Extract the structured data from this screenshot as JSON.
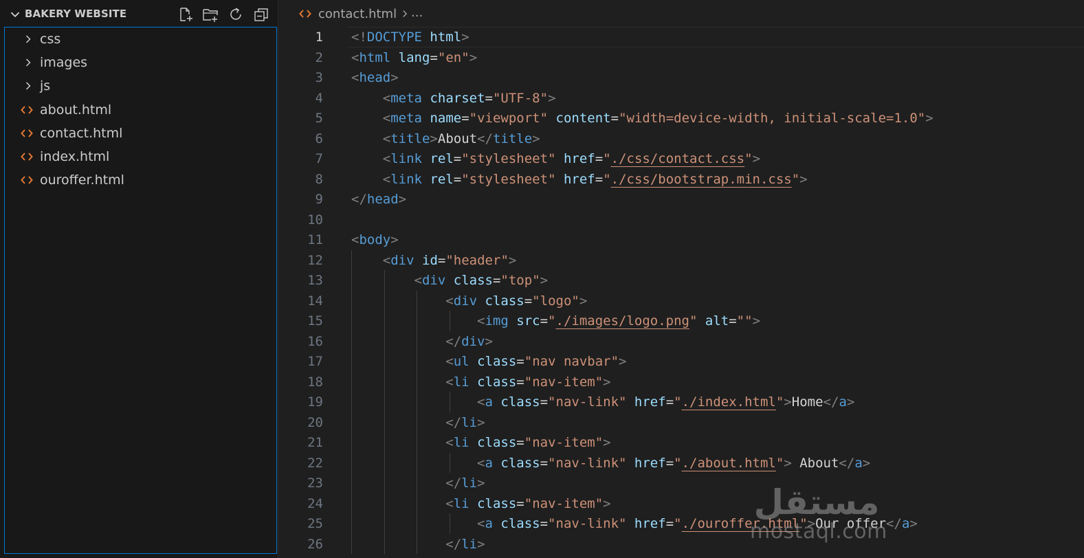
{
  "explorer": {
    "title": "BAKERY WEBSITE",
    "actions": [
      {
        "name": "new-file-icon"
      },
      {
        "name": "new-folder-icon"
      },
      {
        "name": "refresh-icon"
      },
      {
        "name": "collapse-all-icon"
      }
    ],
    "items": [
      {
        "label": "css",
        "type": "folder"
      },
      {
        "label": "images",
        "type": "folder"
      },
      {
        "label": "js",
        "type": "folder"
      },
      {
        "label": "about.html",
        "type": "file"
      },
      {
        "label": "contact.html",
        "type": "file"
      },
      {
        "label": "index.html",
        "type": "file"
      },
      {
        "label": "ouroffer.html",
        "type": "file"
      }
    ]
  },
  "breadcrumb": {
    "file": "contact.html",
    "more": "..."
  },
  "editor": {
    "active_line": 1,
    "lines": [
      {
        "num": "1",
        "text": "<!DOCTYPE html>"
      },
      {
        "num": "2",
        "text": "<html lang=\"en\">"
      },
      {
        "num": "3",
        "text": "<head>"
      },
      {
        "num": "4",
        "text": "    <meta charset=\"UTF-8\">"
      },
      {
        "num": "5",
        "text": "    <meta name=\"viewport\" content=\"width=device-width, initial-scale=1.0\">"
      },
      {
        "num": "6",
        "text": "    <title>About</title>"
      },
      {
        "num": "7",
        "text": "    <link rel=\"stylesheet\" href=\"./css/contact.css\">"
      },
      {
        "num": "8",
        "text": "    <link rel=\"stylesheet\" href=\"./css/bootstrap.min.css\">"
      },
      {
        "num": "9",
        "text": "</head>"
      },
      {
        "num": "10",
        "text": ""
      },
      {
        "num": "11",
        "text": "<body>"
      },
      {
        "num": "12",
        "text": "    <div id=\"header\">"
      },
      {
        "num": "13",
        "text": "        <div class=\"top\">"
      },
      {
        "num": "14",
        "text": "            <div class=\"logo\">"
      },
      {
        "num": "15",
        "text": "                <img src=\"./images/logo.png\" alt=\"\">"
      },
      {
        "num": "16",
        "text": "            </div>"
      },
      {
        "num": "17",
        "text": "            <ul class=\"nav navbar\">"
      },
      {
        "num": "18",
        "text": "            <li class=\"nav-item\">"
      },
      {
        "num": "19",
        "text": "                <a class=\"nav-link\" href=\"./index.html\">Home</a>"
      },
      {
        "num": "20",
        "text": "            </li>"
      },
      {
        "num": "21",
        "text": "            <li class=\"nav-item\">"
      },
      {
        "num": "22",
        "text": "                <a class=\"nav-link\" href=\"./about.html\"> About</a>"
      },
      {
        "num": "23",
        "text": "            </li>"
      },
      {
        "num": "24",
        "text": "            <li class=\"nav-item\">"
      },
      {
        "num": "25",
        "text": "                <a class=\"nav-link\" href=\"./ouroffer.html\">Our offer</a>"
      },
      {
        "num": "26",
        "text": "            </li>"
      }
    ]
  },
  "watermark": {
    "text": "mostaql.com",
    "logo_text": "مستقل"
  },
  "colors": {
    "sidebar_bg": "#181818",
    "editor_bg": "#1f1f1f",
    "focus_border": "#0078d4",
    "html_file_icon": "#e37933",
    "tag": "#569cd6",
    "attribute": "#9cdcfe",
    "string": "#ce9178",
    "punctuation": "#808080",
    "text": "#d4d4d4"
  }
}
